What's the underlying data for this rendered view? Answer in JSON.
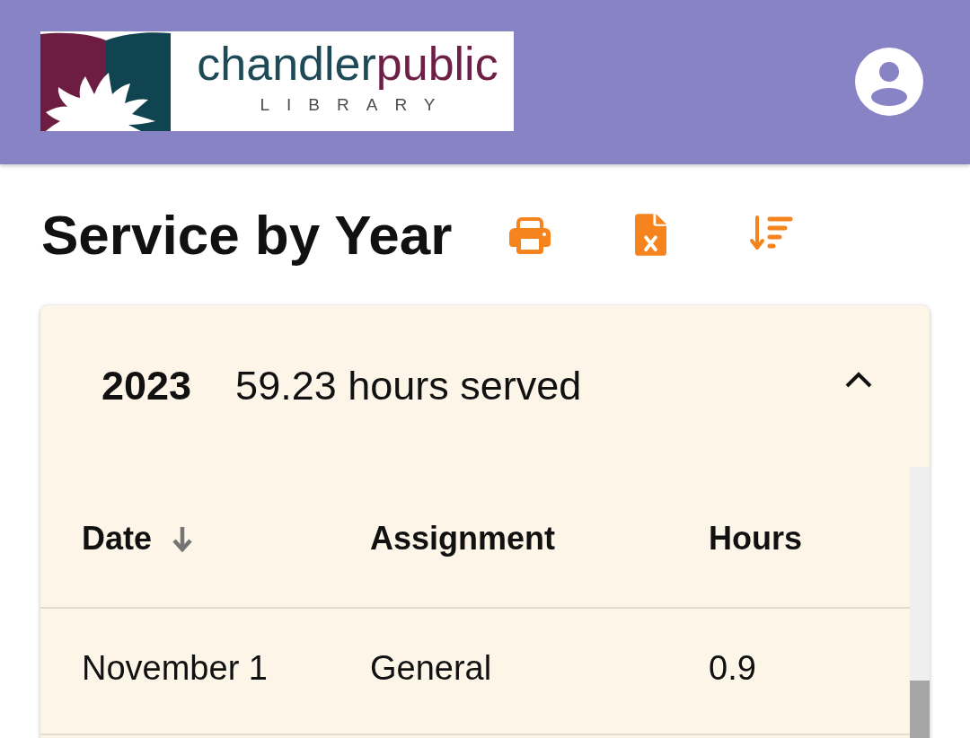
{
  "header": {
    "logo": {
      "name": "chandler",
      "name_accent": "public",
      "subtitle": "LIBRARY"
    }
  },
  "page": {
    "title": "Service by Year"
  },
  "years": [
    {
      "year": "2023",
      "summary": "59.23 hours served",
      "expanded": true,
      "table": {
        "columns": [
          {
            "label": "Date",
            "sorted": true
          },
          {
            "label": "Assignment",
            "sorted": false
          },
          {
            "label": "Hours",
            "sorted": false
          }
        ],
        "rows": [
          [
            "November 1",
            "General",
            "0.9"
          ]
        ]
      }
    }
  ]
}
